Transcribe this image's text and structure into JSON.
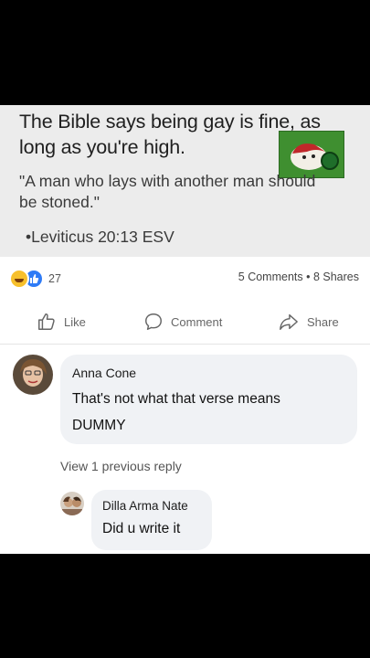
{
  "post": {
    "headline": "The Bible says being gay is fine, as long as you're high.",
    "quote": "\"A man who lays with another man should be stoned.\"",
    "citation": "•Leviticus 20:13 ESV"
  },
  "reactions": {
    "icons": [
      "haha-reaction-icon",
      "like-reaction-icon"
    ],
    "count": "27"
  },
  "stats": {
    "text": "5 Comments • 8 Shares"
  },
  "actions": {
    "like": "Like",
    "comment": "Comment",
    "share": "Share"
  },
  "comments": [
    {
      "author": "Anna Cone",
      "text": "That's not what that verse means DUMMY"
    }
  ],
  "view_previous": "View 1 previous reply",
  "reply": {
    "author": "Dilla Arma Nate",
    "text": "Did u write it"
  },
  "colors": {
    "like_blue": "#2e7bf6",
    "haha_yellow": "#f7c02c",
    "bubble_bg": "#f0f2f5"
  }
}
